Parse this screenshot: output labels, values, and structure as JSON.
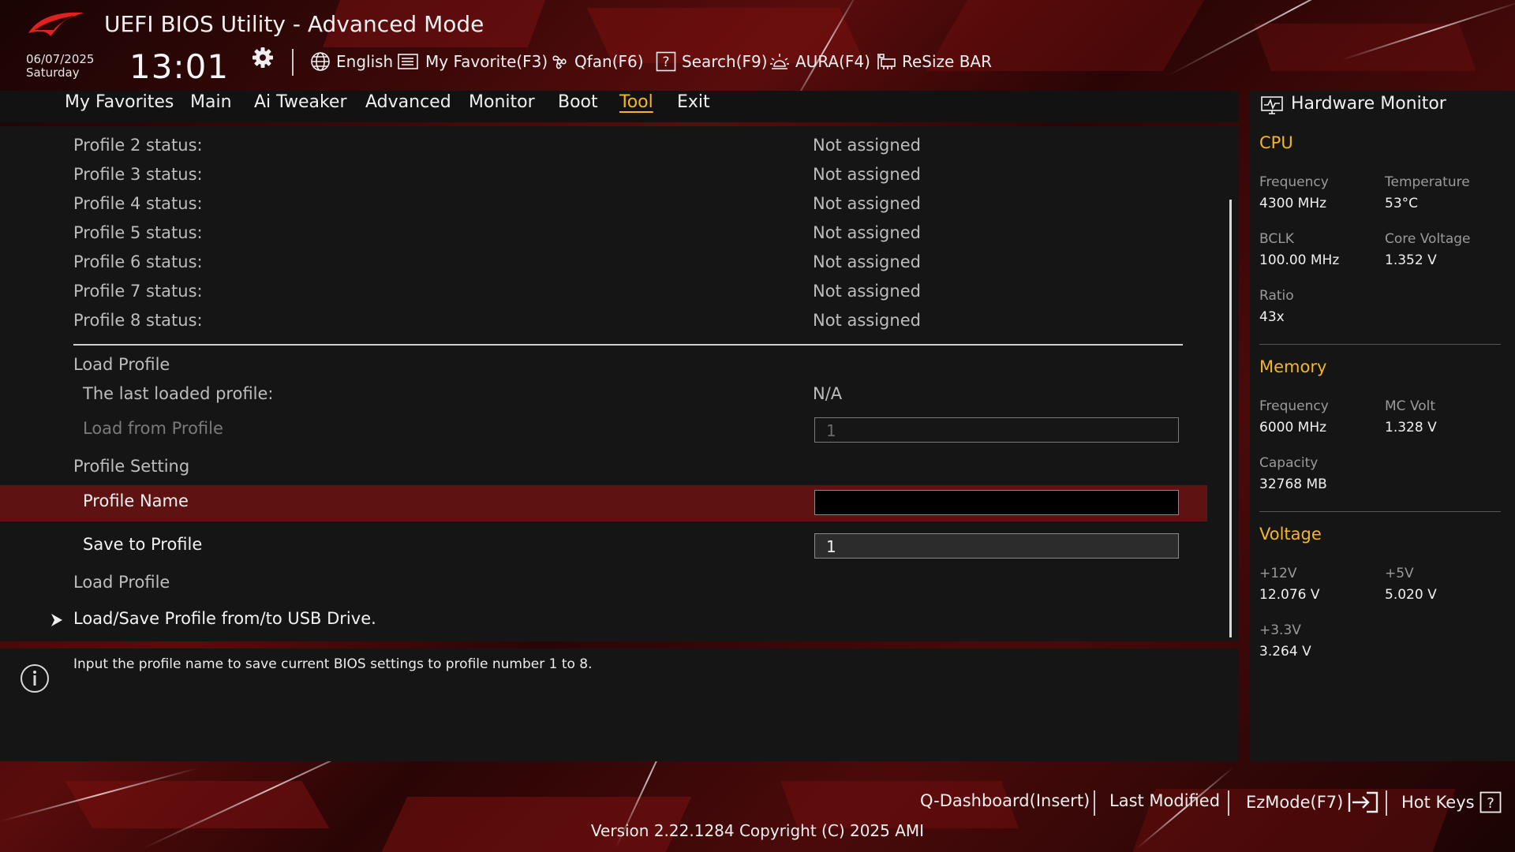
{
  "header": {
    "title": "UEFI BIOS Utility - Advanced Mode",
    "date": "06/07/2025",
    "day": "Saturday",
    "time": "13:01",
    "tools": [
      {
        "label": "English",
        "icon": "globe-icon"
      },
      {
        "label": "My Favorite(F3)",
        "icon": "favorite-list-icon"
      },
      {
        "label": "Qfan(F6)",
        "icon": "fan-icon"
      },
      {
        "label": "Search(F9)",
        "icon": "search-question-icon"
      },
      {
        "label": "AURA(F4)",
        "icon": "aura-light-icon"
      },
      {
        "label": "ReSize BAR",
        "icon": "resize-bar-icon"
      }
    ]
  },
  "tabs": [
    "My Favorites",
    "Main",
    "Ai Tweaker",
    "Advanced",
    "Monitor",
    "Boot",
    "Tool",
    "Exit"
  ],
  "active_tab": "Tool",
  "main": {
    "profiles": [
      {
        "label": "Profile 2 status:",
        "value": "Not assigned"
      },
      {
        "label": "Profile 3 status:",
        "value": "Not assigned"
      },
      {
        "label": "Profile 4 status:",
        "value": "Not assigned"
      },
      {
        "label": "Profile 5 status:",
        "value": "Not assigned"
      },
      {
        "label": "Profile 6 status:",
        "value": "Not assigned"
      },
      {
        "label": "Profile 7 status:",
        "value": "Not assigned"
      },
      {
        "label": "Profile 8 status:",
        "value": "Not assigned"
      }
    ],
    "load_profile_heading": "Load Profile",
    "last_loaded_label": "The last loaded profile:",
    "last_loaded_value": "N/A",
    "load_from_label": "Load from Profile",
    "load_from_value": "1",
    "profile_setting_heading": "Profile Setting",
    "profile_name_label": "Profile Name",
    "profile_name_value": "",
    "save_to_label": "Save to Profile",
    "save_to_value": "1",
    "load_profile_item": "Load Profile",
    "usb_item": "Load/Save Profile from/to USB Drive."
  },
  "help": {
    "text": "Input the profile name to save current BIOS settings to profile number 1 to 8."
  },
  "hardware_monitor": {
    "title": "Hardware Monitor",
    "cpu": {
      "heading": "CPU",
      "frequency_label": "Frequency",
      "frequency": "4300 MHz",
      "temperature_label": "Temperature",
      "temperature": "53°C",
      "bclk_label": "BCLK",
      "bclk": "100.00 MHz",
      "core_voltage_label": "Core Voltage",
      "core_voltage": "1.352 V",
      "ratio_label": "Ratio",
      "ratio": "43x"
    },
    "memory": {
      "heading": "Memory",
      "frequency_label": "Frequency",
      "frequency": "6000 MHz",
      "mc_volt_label": "MC Volt",
      "mc_volt": "1.328 V",
      "capacity_label": "Capacity",
      "capacity": "32768 MB"
    },
    "voltage": {
      "heading": "Voltage",
      "v12_label": "+12V",
      "v12": "12.076 V",
      "v5_label": "+5V",
      "v5": "5.020 V",
      "v33_label": "+3.3V",
      "v33": "3.264 V"
    }
  },
  "footer": {
    "q_dashboard": "Q-Dashboard(Insert)",
    "last_modified": "Last Modified",
    "ezmode": "EzMode(F7)",
    "hot_keys": "Hot Keys",
    "version": "Version 2.22.1284 Copyright (C) 2025 AMI"
  },
  "colors": {
    "accent": "#f4b71d",
    "highlight_row": "#5e1212",
    "panel": "#151515"
  }
}
